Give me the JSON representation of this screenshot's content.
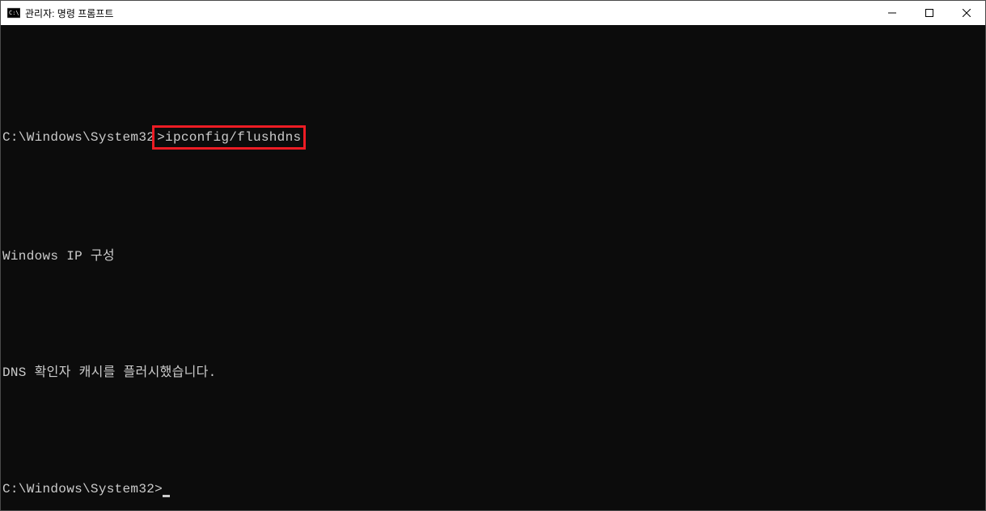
{
  "window": {
    "title": "관리자: 명령 프롬프트"
  },
  "terminal": {
    "prompt1": "C:\\Windows\\System32",
    "command1": ">ipconfig/flushdns",
    "output_line1": "Windows IP 구성",
    "output_line2": "DNS 확인자 캐시를 플러시했습니다.",
    "prompt2": "C:\\Windows\\System32>"
  }
}
